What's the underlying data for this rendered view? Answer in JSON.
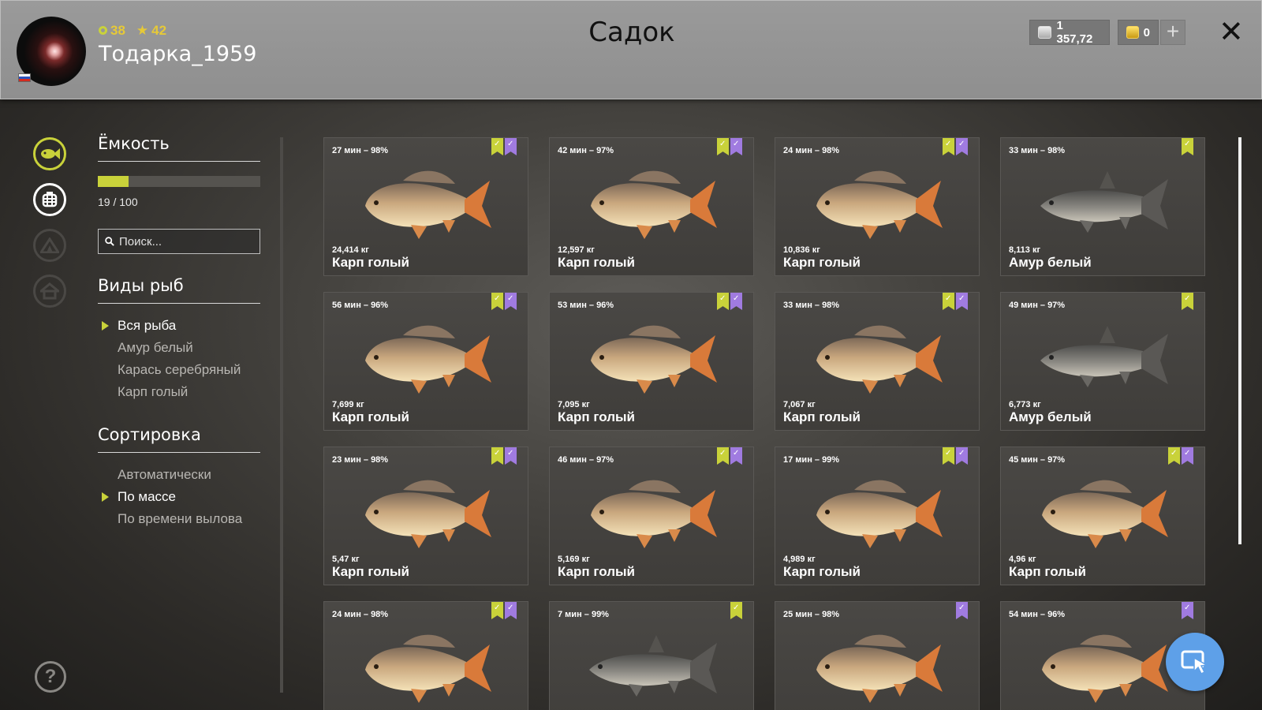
{
  "header": {
    "title": "Садок",
    "level": "38",
    "rating": "42",
    "username": "Тодарка_1959",
    "silver": "1 357,72",
    "gold": "0"
  },
  "capacity": {
    "label": "Ёмкость",
    "text": "19 / 100",
    "current": 19,
    "max": 100
  },
  "search": {
    "placeholder": "Поиск..."
  },
  "species": {
    "title": "Виды рыб",
    "items": [
      {
        "label": "Вся рыба",
        "active": true
      },
      {
        "label": "Амур белый",
        "active": false
      },
      {
        "label": "Карась серебряный",
        "active": false
      },
      {
        "label": "Карп голый",
        "active": false
      }
    ]
  },
  "sorting": {
    "title": "Сортировка",
    "items": [
      {
        "label": "Автоматически",
        "active": false
      },
      {
        "label": "По массе",
        "active": true
      },
      {
        "label": "По времени вылова",
        "active": false
      }
    ]
  },
  "fish": [
    {
      "time": "27 мин – 98%",
      "weight": "24,414 кг",
      "name": "Карп голый",
      "kind": "carp",
      "green": true,
      "purple": true
    },
    {
      "time": "42 мин – 97%",
      "weight": "12,597 кг",
      "name": "Карп голый",
      "kind": "carp",
      "green": true,
      "purple": true
    },
    {
      "time": "24 мин – 98%",
      "weight": "10,836 кг",
      "name": "Карп голый",
      "kind": "carp",
      "green": true,
      "purple": true
    },
    {
      "time": "33 мин – 98%",
      "weight": "8,113 кг",
      "name": "Амур белый",
      "kind": "amur",
      "green": true,
      "purple": false
    },
    {
      "time": "56 мин – 96%",
      "weight": "7,699 кг",
      "name": "Карп голый",
      "kind": "carp",
      "green": true,
      "purple": true
    },
    {
      "time": "53 мин – 96%",
      "weight": "7,095 кг",
      "name": "Карп голый",
      "kind": "carp",
      "green": true,
      "purple": true
    },
    {
      "time": "33 мин – 98%",
      "weight": "7,067 кг",
      "name": "Карп голый",
      "kind": "carp",
      "green": true,
      "purple": true
    },
    {
      "time": "49 мин – 97%",
      "weight": "6,773 кг",
      "name": "Амур белый",
      "kind": "amur",
      "green": true,
      "purple": false
    },
    {
      "time": "23 мин – 98%",
      "weight": "5,47 кг",
      "name": "Карп голый",
      "kind": "carp",
      "green": true,
      "purple": true
    },
    {
      "time": "46 мин – 97%",
      "weight": "5,169 кг",
      "name": "Карп голый",
      "kind": "carp",
      "green": true,
      "purple": true
    },
    {
      "time": "17 мин – 99%",
      "weight": "4,989 кг",
      "name": "Карп голый",
      "kind": "carp",
      "green": true,
      "purple": true
    },
    {
      "time": "45 мин – 97%",
      "weight": "4,96 кг",
      "name": "Карп голый",
      "kind": "carp",
      "green": true,
      "purple": true
    },
    {
      "time": "24 мин – 98%",
      "weight": "",
      "name": "",
      "kind": "carp",
      "green": true,
      "purple": true
    },
    {
      "time": "7 мин – 99%",
      "weight": "",
      "name": "",
      "kind": "amur",
      "green": true,
      "purple": false
    },
    {
      "time": "25 мин – 98%",
      "weight": "",
      "name": "",
      "kind": "carp",
      "green": false,
      "purple": true
    },
    {
      "time": "54 мин – 96%",
      "weight": "",
      "name": "",
      "kind": "carp",
      "green": false,
      "purple": true
    }
  ],
  "colors": {
    "accent": "#c9d23a",
    "purple_badge": "#a07be0",
    "fab": "#5ea0e8"
  },
  "icons": {
    "nav": [
      "fish-icon",
      "keepnet-icon",
      "tent-icon",
      "home-icon"
    ],
    "help": "help-icon",
    "fab": "cursor-icon"
  }
}
